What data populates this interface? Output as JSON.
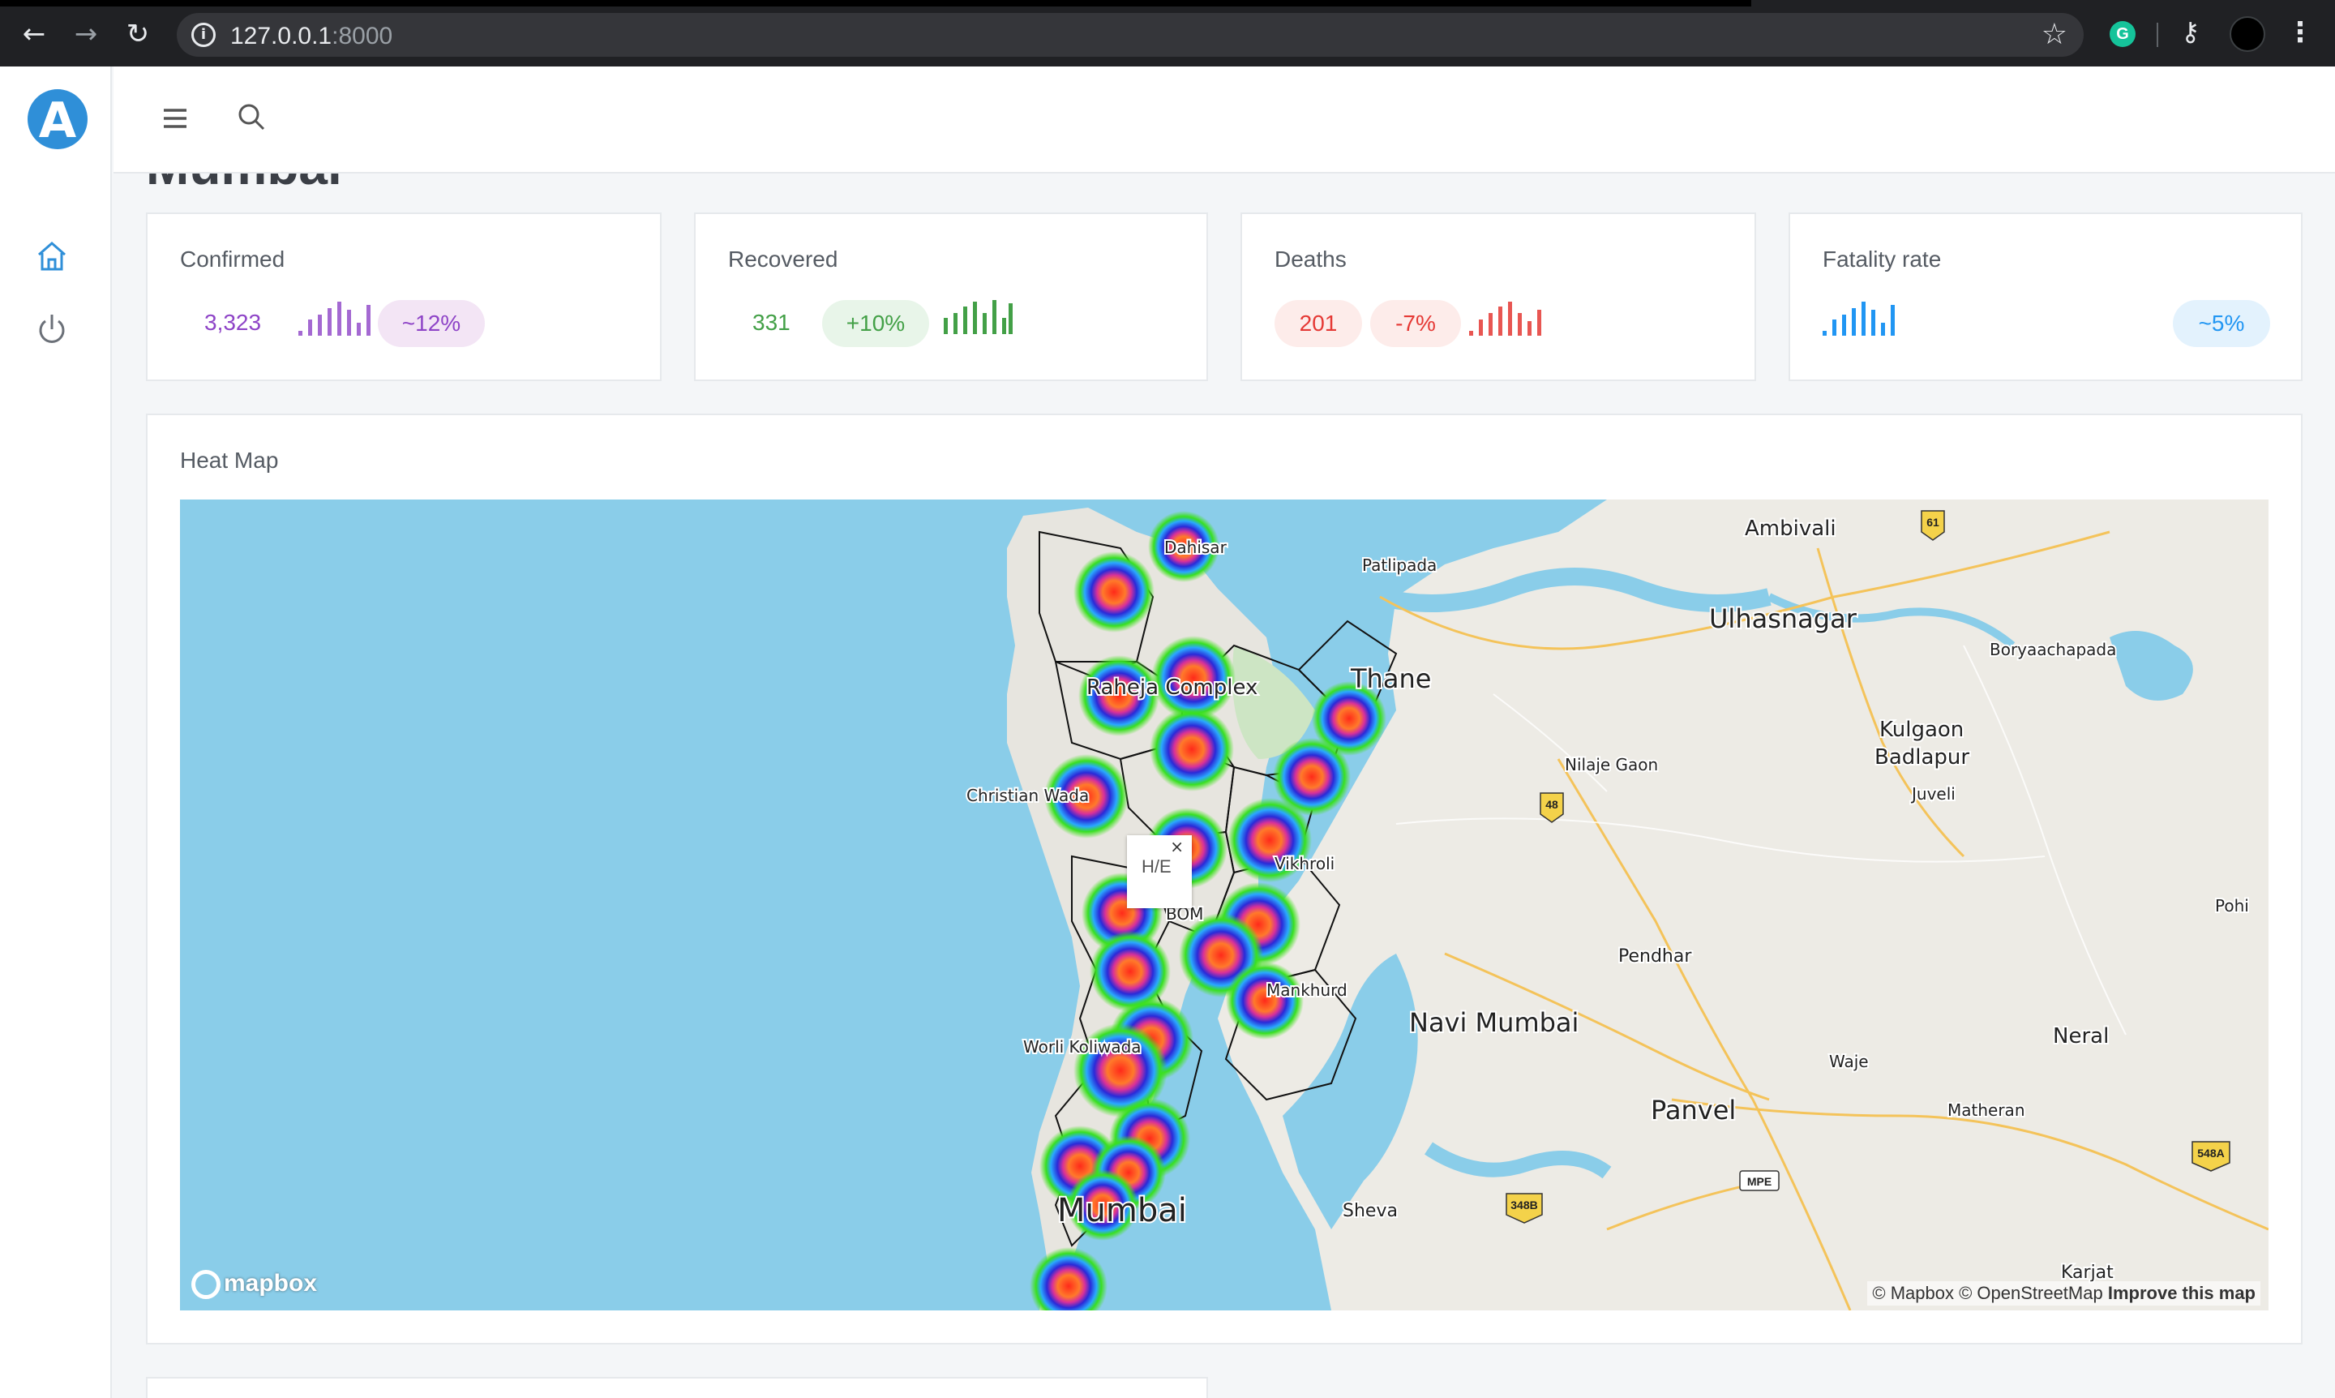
{
  "browser": {
    "url_host": "127.0.0.1",
    "url_port": ":8000"
  },
  "header": {
    "page_title": "Mumbai"
  },
  "cards": {
    "confirmed": {
      "label": "Confirmed",
      "value": "3,323",
      "change": "~12%",
      "color": "#8e44c7"
    },
    "recovered": {
      "label": "Recovered",
      "value": "331",
      "change": "+10%",
      "color": "#43a047"
    },
    "deaths": {
      "label": "Deaths",
      "value": "201",
      "change": "-7%",
      "color": "#e53935"
    },
    "fatality": {
      "label": "Fatality rate",
      "change": "~5%",
      "color": "#2196f3"
    }
  },
  "heatmap": {
    "title": "Heat Map",
    "tooltip": "H/E",
    "attribution": "© Mapbox © OpenStreetMap",
    "improve": "Improve this map",
    "logo": "mapbox",
    "places": {
      "dahisar": "Dahisar",
      "raheja": "Raheja Complex",
      "christian": "Christian Wada",
      "vikhroli": "Vikhroli",
      "mankhurd": "Mankhurd",
      "worli": "Worli Koliwada",
      "mumbai": "Mumbai",
      "thane": "Thane",
      "patlipada": "Patlipada",
      "ambivali": "Ambivali",
      "ulhasnagar": "Ulhasnagar",
      "boryaachapada": "Boryaachapada",
      "kulgaon": "Kulgaon",
      "badlapur": "Badlapur",
      "juveli": "Juveli",
      "nilaje": "Nilaje Gaon",
      "pohi": "Pohi",
      "pendhar": "Pendhar",
      "navimumbai": "Navi Mumbai",
      "neral": "Neral",
      "waje": "Waje",
      "panvel": "Panvel",
      "matheran": "Matheran",
      "sheva": "Sheva",
      "karjat": "Karjat",
      "bom": "BOM"
    },
    "shields": {
      "s61": "61",
      "s48": "48",
      "s348b": "348B",
      "mpe": "MPE",
      "s548a": "548A"
    }
  }
}
